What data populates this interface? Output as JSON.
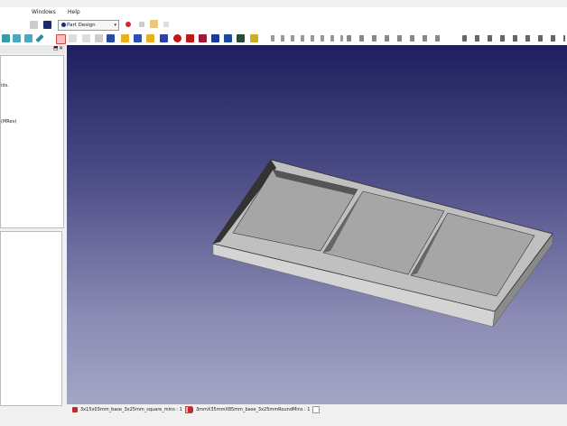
{
  "menu": {
    "windows": "Windows",
    "help": "Help"
  },
  "toolbar": {
    "workbench": "Part Design",
    "workbench_arrow": "▾"
  },
  "left_panel": {
    "close": "✕",
    "float": "⬒",
    "line1": "ids.",
    "line2": "(MRev)"
  },
  "tabs": [
    {
      "label": "3x15x03mm_base_3x25mm_square_mins : 1",
      "active": true
    },
    {
      "label": "3mmX35mmX85mm_base_3x25mmRoundMins : 1",
      "active": false
    }
  ],
  "colors": {
    "viewport_top": "#1f1f5e",
    "viewport_bottom": "#a5a5c6",
    "model": "#a9a9a9"
  }
}
